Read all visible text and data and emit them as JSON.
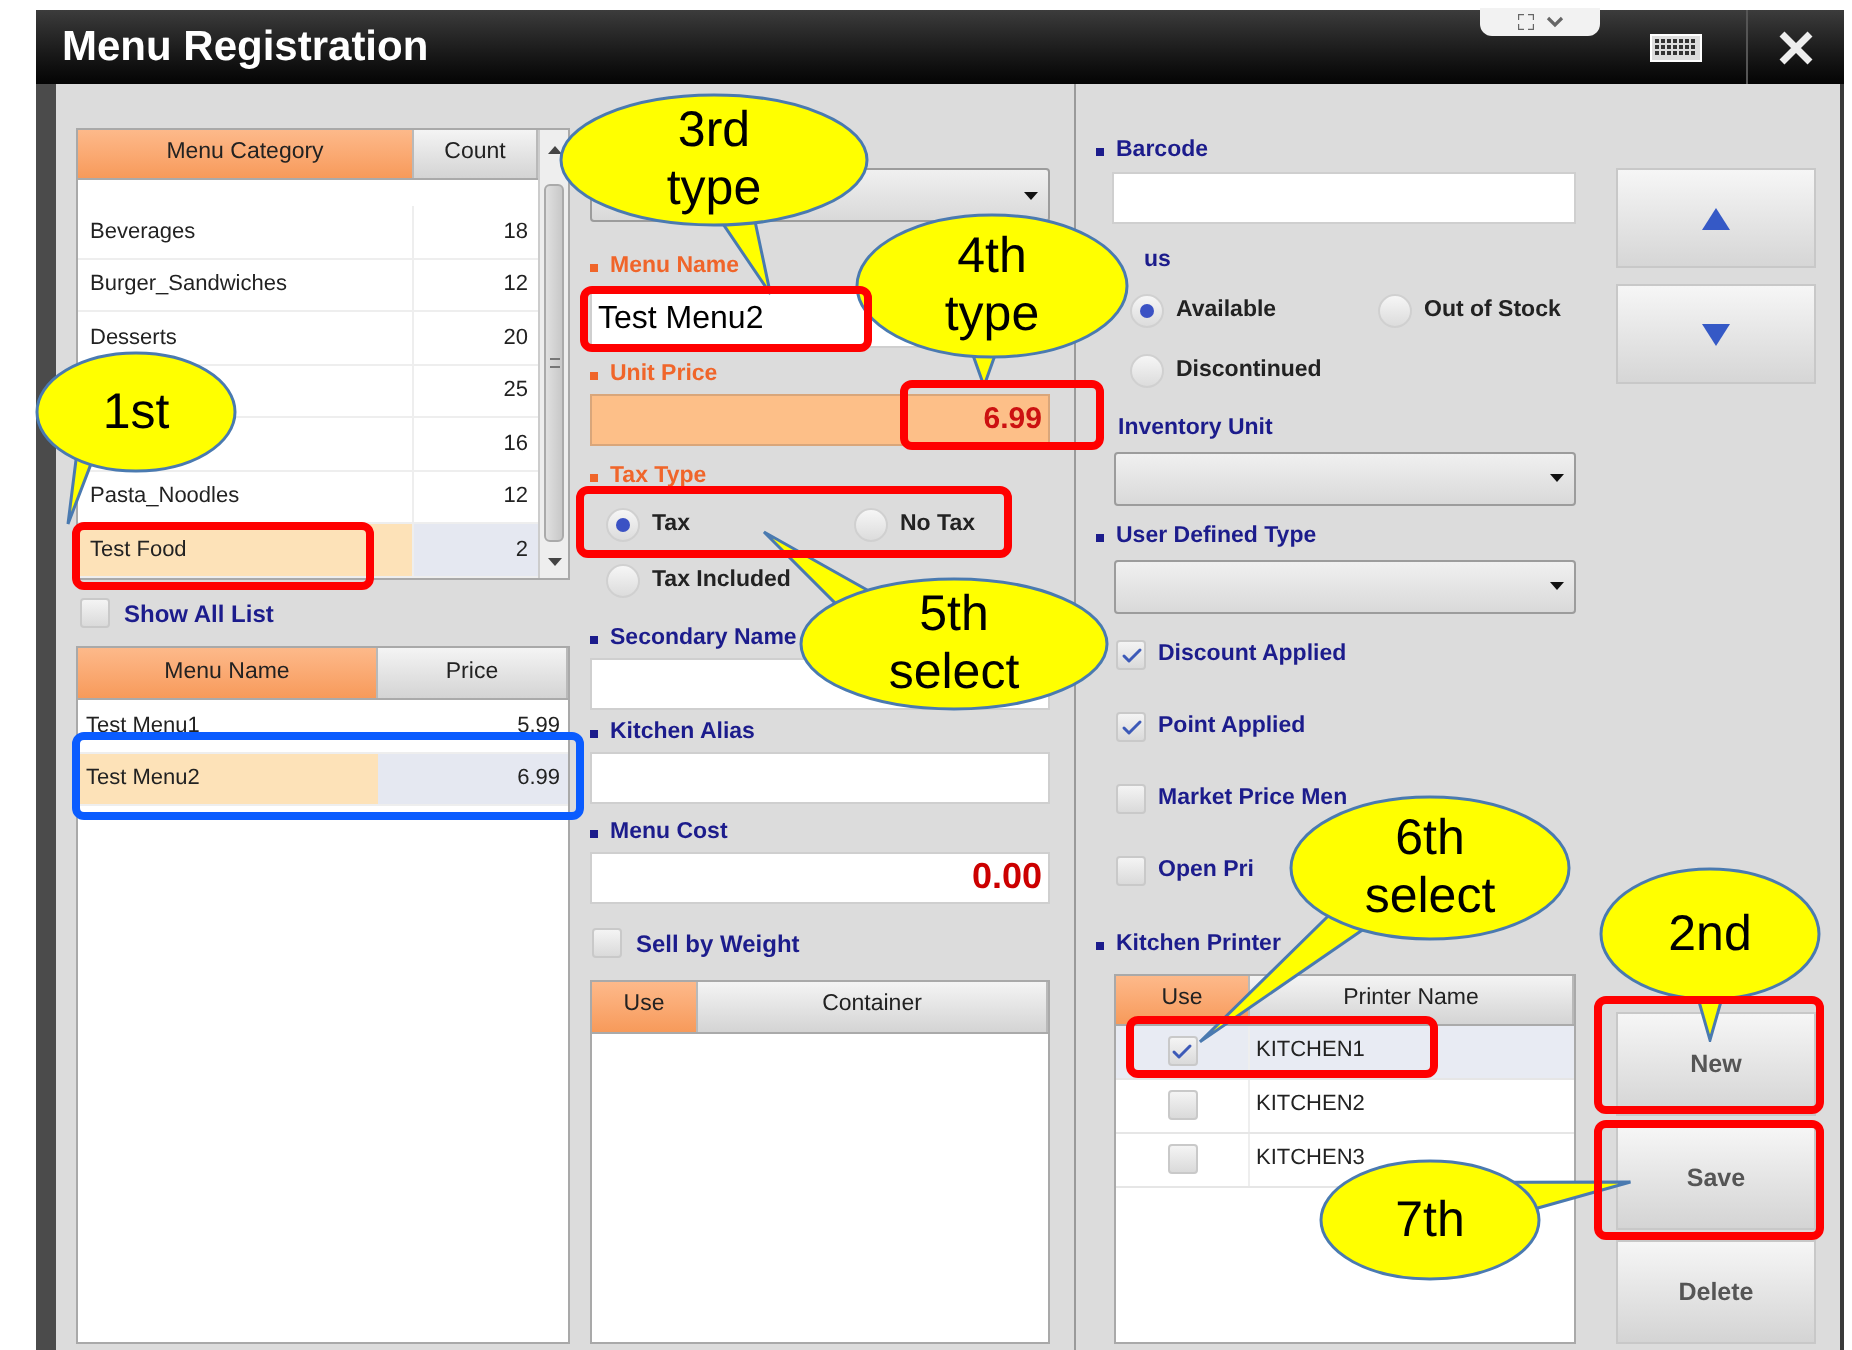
{
  "window": {
    "title": "Menu Registration"
  },
  "category_table": {
    "columns": [
      {
        "label": "Menu Category",
        "highlighted": true
      },
      {
        "label": "Count",
        "highlighted": false
      }
    ],
    "rows": [
      {
        "name": "Beverages",
        "count": "18",
        "selected": false
      },
      {
        "name": "Burger_Sandwiches",
        "count": "12",
        "selected": false
      },
      {
        "name": "Desserts",
        "count": "20",
        "selected": false
      },
      {
        "count": "25",
        "selected": false
      },
      {
        "count": "16",
        "selected": false
      },
      {
        "name": "Pasta_Noodles",
        "count": "12",
        "selected": false
      },
      {
        "name": "Test Food",
        "count": "2",
        "selected": true
      }
    ]
  },
  "show_all_list": {
    "label": "Show All List",
    "checked": false
  },
  "menu_table": {
    "columns": [
      {
        "label": "Menu Name",
        "highlighted": true
      },
      {
        "label": "Price",
        "highlighted": false
      }
    ],
    "rows": [
      {
        "name": "Test Menu1",
        "price": "5.99",
        "selected": false
      },
      {
        "name": "Test Menu2",
        "price": "6.99",
        "selected": true
      }
    ]
  },
  "menu_name": {
    "label": "Menu Name",
    "required": true,
    "value": "Test Menu2"
  },
  "unit_price": {
    "label": "Unit Price",
    "required": true,
    "value": "6.99"
  },
  "tax_type": {
    "label": "Tax Type",
    "required": true,
    "options": [
      {
        "label": "Tax",
        "selected": true
      },
      {
        "label": "No Tax",
        "selected": false
      },
      {
        "label": "Tax Included",
        "selected": false
      }
    ]
  },
  "secondary_name": {
    "label": "Secondary Name",
    "required": false
  },
  "kitchen_alias": {
    "label": "Kitchen Alias",
    "required": false
  },
  "menu_cost": {
    "label": "Menu Cost",
    "required": false,
    "value": "0.00"
  },
  "sell_by_weight": {
    "label": "Sell by Weight",
    "checked": false
  },
  "container_table": {
    "columns": [
      {
        "label": "Use",
        "highlighted": true
      },
      {
        "label": "Container",
        "highlighted": false
      }
    ]
  },
  "barcode": {
    "label": "Barcode",
    "required": false
  },
  "status": {
    "label": "us",
    "options": [
      {
        "label": "Available",
        "selected": true
      },
      {
        "label": "Out of Stock",
        "selected": false
      },
      {
        "label": "Discontinued",
        "selected": false
      }
    ]
  },
  "inventory_unit": {
    "label": "Inventory Unit"
  },
  "user_defined_type": {
    "label": "User Defined Type",
    "required": false
  },
  "options": [
    {
      "label": "Discount Applied",
      "checked": true
    },
    {
      "label": "Point Applied",
      "checked": true
    },
    {
      "label": "Market Price Men",
      "checked": false
    },
    {
      "label": "Open Pri",
      "checked": false
    }
  ],
  "kitchen_printer": {
    "label": "Kitchen Printer",
    "required": false,
    "columns": [
      {
        "label": "Use",
        "highlighted": true
      },
      {
        "label": "Printer Name",
        "highlighted": false
      }
    ],
    "rows": [
      {
        "name": "KITCHEN1",
        "checked": true,
        "selected": true
      },
      {
        "name": "KITCHEN2",
        "checked": false,
        "selected": false
      },
      {
        "name": "KITCHEN3",
        "checked": false,
        "selected": false
      }
    ]
  },
  "buttons": [
    {
      "label": "New"
    },
    {
      "label": "Save"
    },
    {
      "label": "Delete"
    }
  ],
  "callouts": [
    {
      "text": "3rd type"
    },
    {
      "text": "4th type"
    },
    {
      "text": "1st"
    },
    {
      "text": "5th select"
    },
    {
      "text": "6th select"
    },
    {
      "text": "2nd"
    },
    {
      "text": "7th"
    }
  ]
}
